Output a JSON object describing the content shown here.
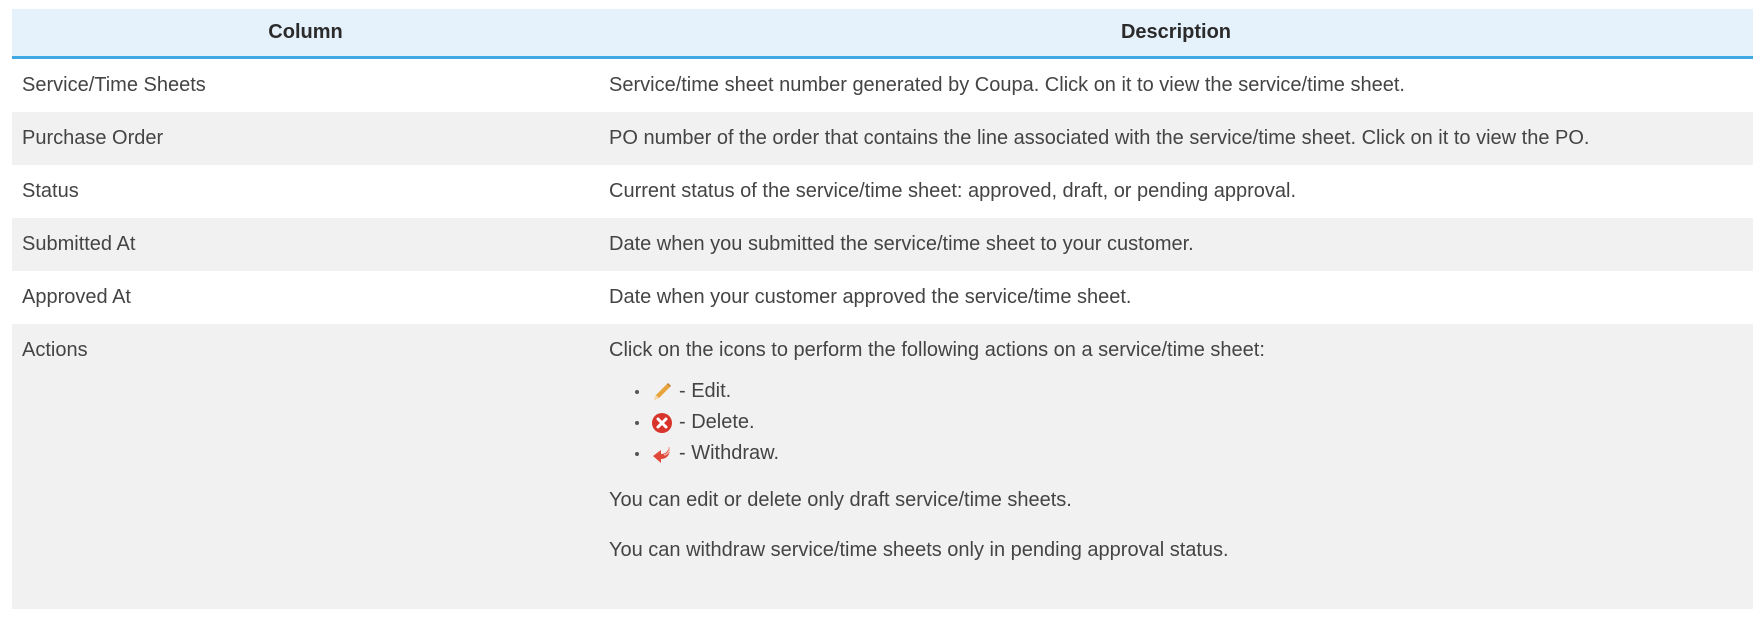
{
  "table": {
    "headers": {
      "column": "Column",
      "description": "Description"
    },
    "rows": [
      {
        "column": "Service/Time Sheets",
        "description": "Service/time sheet number generated by Coupa. Click on it to view the service/time sheet."
      },
      {
        "column": "Purchase Order",
        "description": "PO number of the order that contains the line associated with the service/time sheet. Click on it to view the PO."
      },
      {
        "column": "Status",
        "description": "Current status of the service/time sheet: approved, draft, or pending approval."
      },
      {
        "column": "Submitted At",
        "description": "Date when you submitted the service/time sheet to your customer."
      },
      {
        "column": "Approved At",
        "description": "Date when your customer approved the service/time sheet."
      }
    ],
    "actions_row": {
      "column": "Actions",
      "intro": "Click on the icons to perform the following actions on a service/time sheet:",
      "items": [
        {
          "icon": "pencil-icon",
          "label": "- Edit."
        },
        {
          "icon": "delete-icon",
          "label": "- Delete."
        },
        {
          "icon": "withdraw-icon",
          "label": "- Withdraw."
        }
      ],
      "note1": "You can edit or delete only draft service/time sheets.",
      "note2": "You can withdraw service/time sheets only in pending approval status."
    }
  },
  "colors": {
    "header_bg": "#e6f2fb",
    "header_border": "#3fa9e3",
    "stripe_bg": "#f1f1f1",
    "delete_red": "#d9342b",
    "pencil_orange": "#e8a33a"
  }
}
